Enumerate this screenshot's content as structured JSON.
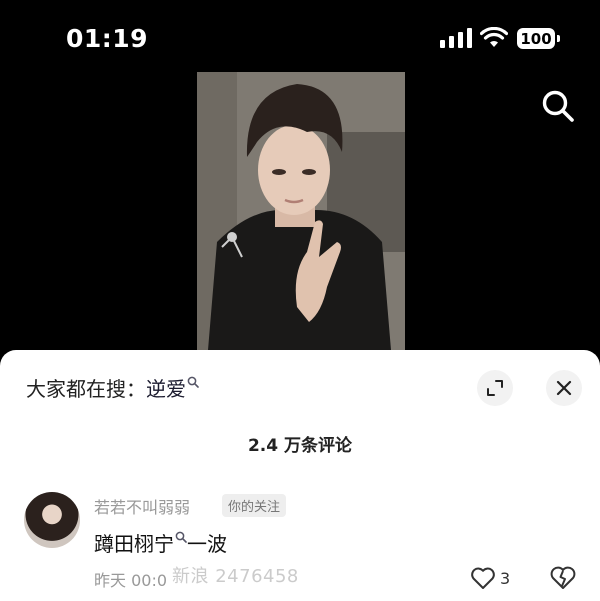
{
  "status_bar": {
    "time": "01:19",
    "battery": "100"
  },
  "sheet": {
    "search_label": "大家都在搜：",
    "search_keyword": "逆爱",
    "comment_count": "2.4 万条评论"
  },
  "comment": {
    "username": "若若不叫弱弱",
    "follow_tag": "你的关注",
    "text_link": "蹲田栩宁",
    "text_rest": "一波",
    "time": "昨天 00:0",
    "like_count": "3"
  },
  "watermark": "新浪 2476458",
  "icons": {
    "search": "search-icon",
    "expand": "expand-icon",
    "close": "close-icon",
    "like": "heart-outline-icon",
    "dislike": "broken-heart-icon"
  }
}
